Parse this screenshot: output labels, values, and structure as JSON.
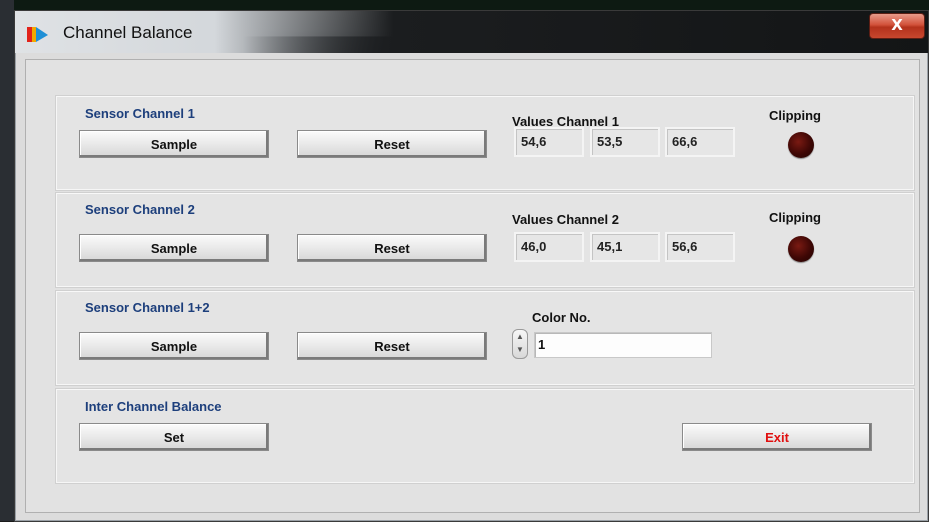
{
  "window": {
    "title": "Channel Balance",
    "close_glyph": "X"
  },
  "channel1": {
    "section_label": "Sensor Channel 1",
    "sample_label": "Sample",
    "reset_label": "Reset",
    "values_label": "Values Channel 1",
    "values": [
      "54,6",
      "53,5",
      "66,6"
    ],
    "clipping_label": "Clipping"
  },
  "channel2": {
    "section_label": "Sensor Channel 2",
    "sample_label": "Sample",
    "reset_label": "Reset",
    "values_label": "Values Channel 2",
    "values": [
      "46,0",
      "45,1",
      "56,6"
    ],
    "clipping_label": "Clipping"
  },
  "channel12": {
    "section_label": "Sensor Channel 1+2",
    "sample_label": "Sample",
    "reset_label": "Reset",
    "color_label": "Color No.",
    "color_value": "1"
  },
  "balance": {
    "section_label": "Inter Channel Balance",
    "set_label": "Set",
    "exit_label": "Exit"
  },
  "colors": {
    "section_label": "#1d3f7c",
    "exit_text": "#e01010",
    "led_off": "#3e0705"
  },
  "icons": {
    "app": "app-logo-icon",
    "close": "close-icon",
    "stepper": "stepper-updown-icon"
  }
}
